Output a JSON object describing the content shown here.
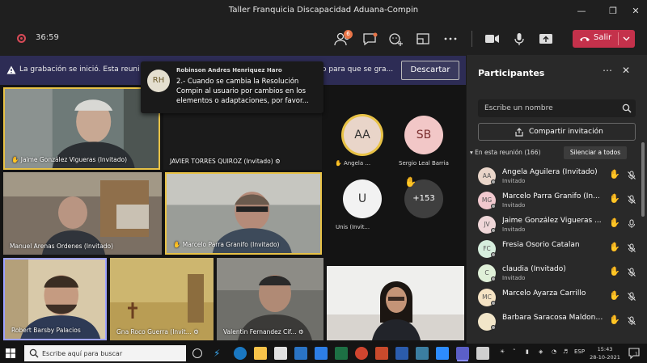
{
  "window": {
    "title": "Taller Franquicia Discapacidad Aduana-Compin"
  },
  "toolbar": {
    "timer": "36:59",
    "participants_badge": "6",
    "leave_label": "Salir"
  },
  "banner": {
    "text": "La grabación se inició. Esta reuni",
    "text_tail": "o para que se gra...",
    "discard_label": "Descartar"
  },
  "tooltip": {
    "initials": "RH",
    "author": "Robinson Andres Henriquez Haro",
    "message": "2.- Cuando se cambia la Resolución Compin al usuario por cambios en los elementos o adaptaciones, por favor..."
  },
  "tiles": [
    {
      "name": "Jaime González Vigueras (Invitado)"
    },
    {
      "name": "JAVIER TORRES QUIROZ (Invitado)"
    },
    {
      "name": "Manuel Arenas Ordenes (Invitado)"
    },
    {
      "name": "Marcelo Parra Granifo (Invitado)"
    },
    {
      "name": "Robert Barsby Palacios"
    },
    {
      "name": "Gna Roco Guerra (Invit..."
    },
    {
      "name": "Valentin Fernandez Cif..."
    }
  ],
  "mini": [
    {
      "initials": "AA",
      "name": "Angela ...",
      "color": "#e9d5c9"
    },
    {
      "initials": "SB",
      "name": "Sergio Leal Barria",
      "color": "#f2c7c7"
    },
    {
      "initials": "U",
      "name": "Unis (Invit...",
      "color": "#f2f2f2"
    },
    {
      "initials": "+153",
      "name": ""
    }
  ],
  "panel": {
    "title": "Participantes",
    "search_placeholder": "Escribe un nombre",
    "share_label": "Compartir invitación",
    "section": "En esta reunión (166)",
    "mute_all": "Silenciar a todos",
    "people": [
      {
        "initials": "AA",
        "name": "Angela Aguilera (Invitado)",
        "role": "Invitado",
        "color": "#e9d5c9"
      },
      {
        "initials": "MG",
        "name": "Marcelo Parra Granifo (In...",
        "role": "Invitado",
        "color": "#f1c9cf"
      },
      {
        "initials": "JV",
        "name": "Jaime González Vigueras ...",
        "role": "Invitado",
        "color": "#efd6d8"
      },
      {
        "initials": "FC",
        "name": "Fresia Osorio Catalan",
        "role": "",
        "color": "#d6eedd"
      },
      {
        "initials": "C",
        "name": "claudia (Invitado)",
        "role": "Invitado",
        "color": "#dff0d8"
      },
      {
        "initials": "MC",
        "name": "Marcelo Ayarza Carrillo",
        "role": "",
        "color": "#f5e3c4"
      },
      {
        "initials": "",
        "name": "Barbara Saracosa Maldonado",
        "role": "",
        "color": "#f2e6c9"
      }
    ]
  },
  "taskbar": {
    "search_placeholder": "Escribe aquí para buscar",
    "lang": "ESP",
    "time": "15:43",
    "date": "28-10-2021",
    "notif_count": "1"
  }
}
